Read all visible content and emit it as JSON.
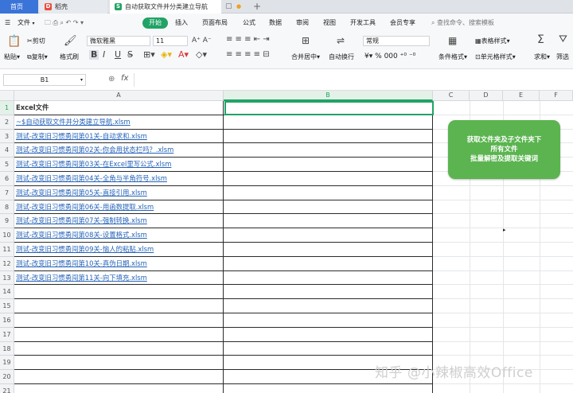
{
  "tabs": {
    "home": "首页",
    "daoke": "稻壳",
    "doc": "自动获取文件并分类建立导航",
    "new_tab": "+"
  },
  "menu": {
    "file": "文件",
    "start": "开始",
    "insert": "插入",
    "page_layout": "页面布局",
    "formula": "公式",
    "data": "数据",
    "review": "审阅",
    "view": "视图",
    "dev_tools": "开发工具",
    "member": "会员专享",
    "search_placeholder": "查找命令、搜索模板"
  },
  "toolbar": {
    "cut": "剪切",
    "paste": "粘贴",
    "copy": "复制",
    "format_painter": "格式刷",
    "font_name": "微软雅黑",
    "font_size": "11",
    "merge_center": "合并居中",
    "wrap_text": "自动换行",
    "number_format": "常规",
    "conditional_format": "条件格式",
    "table_style": "表格样式",
    "cell_style": "单元格样式",
    "sum": "求和",
    "filter": "筛选",
    "bold": "B",
    "italic": "I",
    "underline": "U",
    "font_color": "A",
    "currency": "¥",
    "percent": "%",
    "thousands": "000"
  },
  "formula_bar": {
    "name_box": "B1",
    "fx": "fx",
    "value": ""
  },
  "columns": [
    "A",
    "B",
    "C",
    "D",
    "E",
    "F"
  ],
  "rows": [
    "1",
    "2",
    "3",
    "4",
    "5",
    "6",
    "7",
    "8",
    "9",
    "10",
    "11",
    "12",
    "13",
    "14",
    "15",
    "16",
    "17",
    "18",
    "19",
    "20",
    "21"
  ],
  "cells": {
    "A1": "Excel文件",
    "A2": "~$自动获取文件并分类建立导航.xlsm",
    "A3": "测试-改变旧习惯勇闯第01关-自动求和.xlsm",
    "A4": "测试-改变旧习惯勇闯第02关-你会用状态栏吗？.xlsm",
    "A5": "测试-改变旧习惯勇闯第03关-在Excel里写公式.xlsm",
    "A6": "测试-改变旧习惯勇闯第04关-全角与半角符号.xlsm",
    "A7": "测试-改变旧习惯勇闯第05关-直接引用.xlsm",
    "A8": "测试-改变旧习惯勇闯第06关-用函数提取.xlsm",
    "A9": "测试-改变旧习惯勇闯第07关-强制转换.xlsm",
    "A10": "测试-改变旧习惯勇闯第08关-设置格式.xlsm",
    "A11": "测试-改变旧习惯勇闯第09关-恼人的粘贴.xlsm",
    "A12": "测试-改变旧习惯勇闯第10关-真伪日期.xlsm",
    "A13": "测试-改变旧习惯勇闯第11关-向下填充.xlsm"
  },
  "macro_button": {
    "line1": "获取文件夹及子文件夹下",
    "line2": "所有文件",
    "line3": "批量解密及提取关键词"
  },
  "watermark": "知乎 @小辣椒高效Office",
  "colors": {
    "accent": "#21a366",
    "link": "#2563b8",
    "button": "#5bb450",
    "tab_home": "#3a74d8"
  }
}
